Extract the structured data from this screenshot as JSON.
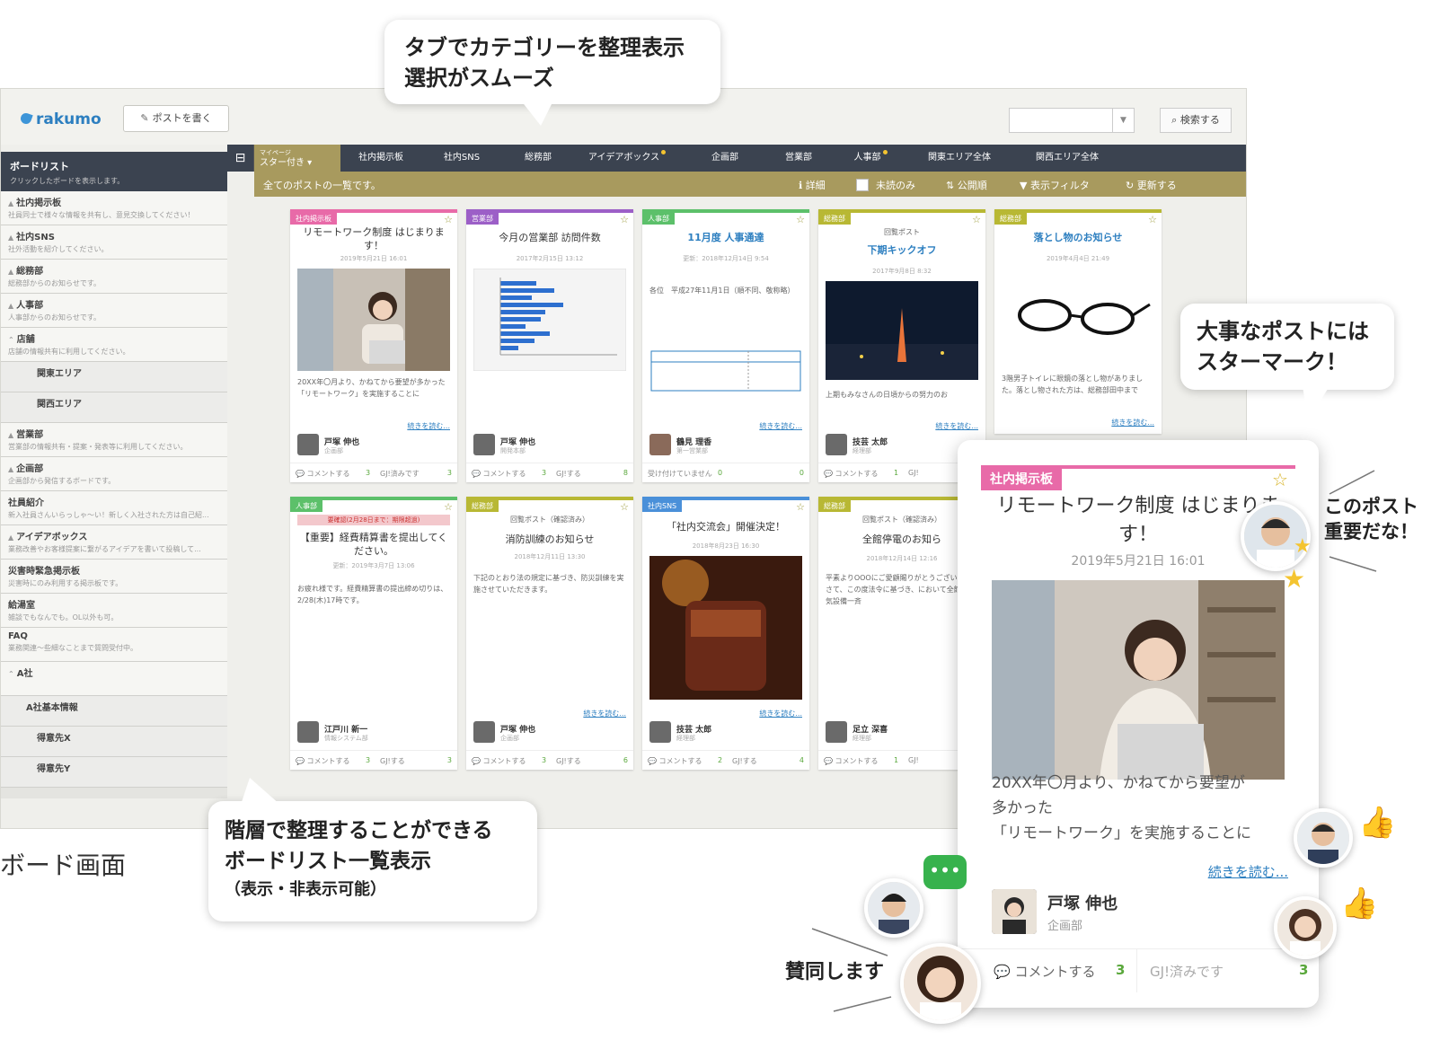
{
  "app": {
    "logo": "rakumo",
    "post_button": "ポストを書く",
    "search_button": "検索する"
  },
  "tabs": {
    "mypage_small": "マイページ",
    "mypage_label": "スター付き",
    "items": [
      "社内掲示板",
      "社内SNS",
      "総務部",
      "アイデアボックス",
      "企画部",
      "営業部",
      "人事部",
      "関東エリア全体",
      "関西エリア全体"
    ]
  },
  "toolbar": {
    "message": "全てのポストの一覧です。",
    "detail": "詳細",
    "unread": "未読のみ",
    "order": "公開順",
    "filter": "表示フィルタ",
    "refresh": "更新する"
  },
  "sidebar": {
    "title": "ボードリスト",
    "subtitle": "クリックしたボードを表示します。",
    "items": [
      {
        "name": "社内掲示板",
        "desc": "社員同士で様々な情報を共有し、意見交換してください！"
      },
      {
        "name": "社内SNS",
        "desc": "社外活動を紹介してください。"
      },
      {
        "name": "総務部",
        "desc": "総務部からのお知らせです。"
      },
      {
        "name": "人事部",
        "desc": "人事部からのお知らせです。"
      },
      {
        "name": "店舗",
        "desc": "店舗の情報共有に利用してください。"
      },
      {
        "name": "関東エリア",
        "desc": ""
      },
      {
        "name": "関西エリア",
        "desc": ""
      },
      {
        "name": "営業部",
        "desc": "営業部の情報共有・提案・発表等に利用してください。"
      },
      {
        "name": "企画部",
        "desc": "企画部から発信するボードです。"
      },
      {
        "name": "社員紹介",
        "desc": "新入社員さんいらっしゃ〜い！新しく入社された方は自己紹..."
      },
      {
        "name": "アイデアボックス",
        "desc": "業務改善やお客様提案に繋がるアイデアを書いて投稿して..."
      },
      {
        "name": "災害時緊急掲示板",
        "desc": "災害時にのみ利用する掲示板です。"
      },
      {
        "name": "給湯室",
        "desc": "雑談でもなんでも。OL以外も可。"
      },
      {
        "name": "FAQ",
        "desc": "業務関連〜些細なことまで質問受付中。"
      },
      {
        "name": "A社",
        "desc": ""
      },
      {
        "name": "A社基本情報",
        "desc": ""
      },
      {
        "name": "得意先X",
        "desc": ""
      },
      {
        "name": "得意先Y",
        "desc": ""
      }
    ]
  },
  "cards": [
    {
      "tag": "社内掲示板",
      "color": "#e86aa8",
      "title": "リモートワーク制度 はじまります！",
      "date": "2019年5月21日 16:01",
      "body": "20XX年〇月より、かねてから要望が多かった「リモートワーク」を実施することに",
      "author": "戸塚 伸也",
      "dept": "企画部",
      "c": "3",
      "g": "3",
      "gl": "GJ!済みです"
    },
    {
      "tag": "営業部",
      "color": "#9c5fc7",
      "title": "今月の営業部 訪問件数",
      "date": "2017年2月15日 13:12",
      "body": "",
      "author": "戸塚 伸也",
      "dept": "開発本部",
      "c": "3",
      "g": "8",
      "gl": "GJ!する"
    },
    {
      "tag": "人事部",
      "color": "#5cc06a",
      "title": "11月度 人事通達",
      "date": "更新：2018年12月14日 9:54",
      "body": "各位　平成27年11月1日（順不同、敬称略）",
      "author": "鶴見 理香",
      "dept": "第一営業部",
      "c": "0",
      "g": "0",
      "gl": "受け付けていません"
    },
    {
      "tag": "総務部",
      "color": "#b8b834",
      "title": "下期キックオフ",
      "date": "2017年9月8日 8:32",
      "body": "上期もみなさんの日頃からの努力のお",
      "author": "技芸 太郎",
      "dept": "経理部",
      "c": "1",
      "g": "",
      "gl": "GJ!"
    },
    {
      "tag": "総務部",
      "color": "#b8b834",
      "title": "落とし物のお知らせ",
      "date": "2019年4月4日 21:49",
      "body": "3階男子トイレに眼鏡の落とし物がありました。落とし物された方は、総務部田中まで",
      "author": "",
      "dept": "",
      "c": "",
      "g": "",
      "gl": ""
    },
    {
      "tag": "人事部",
      "color": "#5cc06a",
      "title": "【重要】経費精算書を提出してください。",
      "date": "更新：2019年3月7日 13:06",
      "body": "お疲れ様です。経費精算書の提出締め切りは、2/28(木)17時です。",
      "author": "江戸川 新一",
      "dept": "情報システム部",
      "c": "3",
      "g": "3",
      "gl": "GJ!する"
    },
    {
      "tag": "総務部",
      "color": "#b8b834",
      "title": "消防訓練のお知らせ",
      "date": "2018年12月11日 13:30",
      "body": "下記のとおり法の規定に基づき、防災訓練を実施させていただきます。",
      "author": "戸塚 伸也",
      "dept": "企画部",
      "c": "3",
      "g": "6",
      "gl": "GJ!する"
    },
    {
      "tag": "社内SNS",
      "color": "#4a90d9",
      "title": "「社内交流会」開催決定！",
      "date": "2018年8月23日 16:30",
      "body": "",
      "author": "技芸 太郎",
      "dept": "経理部",
      "c": "2",
      "g": "4",
      "gl": "GJ!する"
    },
    {
      "tag": "総務部",
      "color": "#b8b834",
      "title": "全館停電のお知ら",
      "date": "2018年12月14日 12:16",
      "body": "平素よりOOOにご愛顧賜りがとうございます。さて、この度法令に基づき、において全館の電気設備一斉",
      "author": "足立 深喜",
      "dept": "経理部",
      "c": "1",
      "g": "",
      "gl": "GJ!"
    }
  ],
  "card_extras": {
    "more": "続きを読む...",
    "comment": "コメントする",
    "notice": "回覧ポスト",
    "notice_done": "回覧ポスト（確認済み）",
    "deadline": "要確認(2月28日まで：期限超過)"
  },
  "callouts": {
    "tabs_line1": "タブでカテゴリーを整理表示",
    "tabs_line2": "選択がスムーズ",
    "star_line1": "大事なポストには",
    "star_line2": "スターマーク！",
    "list_line1": "階層で整理することができる",
    "list_line2": "ボードリスト一覧表示",
    "list_line3": "（表示・非表示可能）",
    "important_line1": "このポスト",
    "important_line2": "重要だな！",
    "agree": "賛同します",
    "board_label": "ボード画面"
  },
  "zoom": {
    "tag": "社内掲示板",
    "title": "リモートワーク制度 はじまります！",
    "date": "2019年5月21日 16:01",
    "body1": "20XX年〇月より、かねてから要望が",
    "body2": "多かった",
    "body3": "「リモートワーク」を実施することに",
    "more": "続きを読む...",
    "author": "戸塚 伸也",
    "dept": "企画部",
    "comment": "コメントする",
    "comment_count": "3",
    "gj": "GJ!済みです",
    "gj_count": "3"
  }
}
